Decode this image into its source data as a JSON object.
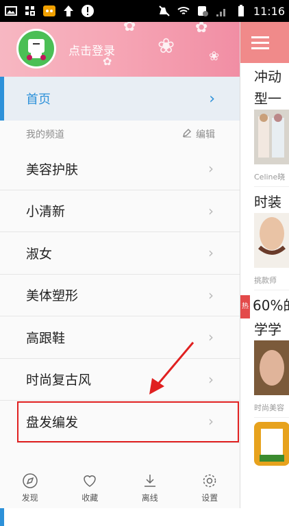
{
  "status": {
    "time": "11:16"
  },
  "header": {
    "login": "点击登录"
  },
  "home": {
    "label": "首页"
  },
  "channels": {
    "title": "我的频道",
    "edit": "编辑"
  },
  "items": [
    {
      "label": "美容护肤"
    },
    {
      "label": "小清新"
    },
    {
      "label": "淑女"
    },
    {
      "label": "美体塑形"
    },
    {
      "label": "高跟鞋"
    },
    {
      "label": "时尚复古风"
    },
    {
      "label": "盘发编发"
    }
  ],
  "tabs": [
    {
      "label": "发现",
      "icon": "compass-icon"
    },
    {
      "label": "收藏",
      "icon": "heart-icon"
    },
    {
      "label": "离线",
      "icon": "download-icon"
    },
    {
      "label": "设置",
      "icon": "gear-icon"
    }
  ],
  "feed": {
    "article1": {
      "title1": "冲动",
      "title2": "型一",
      "source": "Celine晓"
    },
    "article2": {
      "title": "时装",
      "source": "挑款师"
    },
    "article3": {
      "hot": "热",
      "title1": "60%的",
      "title2": "学学",
      "source": "时尚美容"
    }
  },
  "colors": {
    "accent": "#2d91d9",
    "header": "#f6a7b6",
    "highlight": "#e02020",
    "topbar": "#f08a8a"
  }
}
